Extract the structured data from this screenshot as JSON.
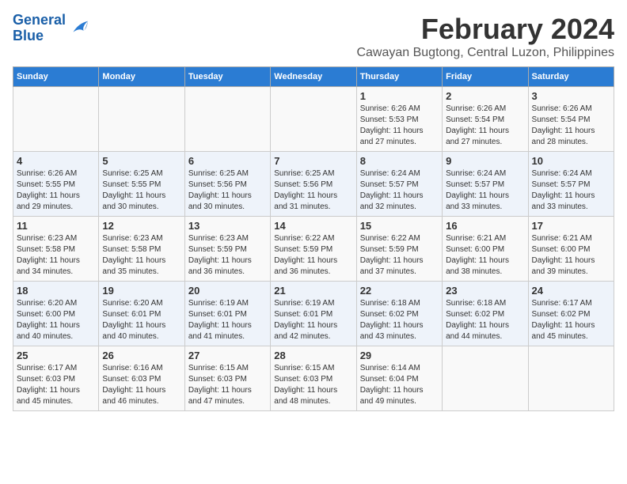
{
  "logo": {
    "line1": "General",
    "line2": "Blue"
  },
  "title": "February 2024",
  "subtitle": "Cawayan Bugtong, Central Luzon, Philippines",
  "days_header": [
    "Sunday",
    "Monday",
    "Tuesday",
    "Wednesday",
    "Thursday",
    "Friday",
    "Saturday"
  ],
  "weeks": [
    [
      {
        "day": "",
        "info": ""
      },
      {
        "day": "",
        "info": ""
      },
      {
        "day": "",
        "info": ""
      },
      {
        "day": "",
        "info": ""
      },
      {
        "day": "1",
        "info": "Sunrise: 6:26 AM\nSunset: 5:53 PM\nDaylight: 11 hours\nand 27 minutes."
      },
      {
        "day": "2",
        "info": "Sunrise: 6:26 AM\nSunset: 5:54 PM\nDaylight: 11 hours\nand 27 minutes."
      },
      {
        "day": "3",
        "info": "Sunrise: 6:26 AM\nSunset: 5:54 PM\nDaylight: 11 hours\nand 28 minutes."
      }
    ],
    [
      {
        "day": "4",
        "info": "Sunrise: 6:26 AM\nSunset: 5:55 PM\nDaylight: 11 hours\nand 29 minutes."
      },
      {
        "day": "5",
        "info": "Sunrise: 6:25 AM\nSunset: 5:55 PM\nDaylight: 11 hours\nand 30 minutes."
      },
      {
        "day": "6",
        "info": "Sunrise: 6:25 AM\nSunset: 5:56 PM\nDaylight: 11 hours\nand 30 minutes."
      },
      {
        "day": "7",
        "info": "Sunrise: 6:25 AM\nSunset: 5:56 PM\nDaylight: 11 hours\nand 31 minutes."
      },
      {
        "day": "8",
        "info": "Sunrise: 6:24 AM\nSunset: 5:57 PM\nDaylight: 11 hours\nand 32 minutes."
      },
      {
        "day": "9",
        "info": "Sunrise: 6:24 AM\nSunset: 5:57 PM\nDaylight: 11 hours\nand 33 minutes."
      },
      {
        "day": "10",
        "info": "Sunrise: 6:24 AM\nSunset: 5:57 PM\nDaylight: 11 hours\nand 33 minutes."
      }
    ],
    [
      {
        "day": "11",
        "info": "Sunrise: 6:23 AM\nSunset: 5:58 PM\nDaylight: 11 hours\nand 34 minutes."
      },
      {
        "day": "12",
        "info": "Sunrise: 6:23 AM\nSunset: 5:58 PM\nDaylight: 11 hours\nand 35 minutes."
      },
      {
        "day": "13",
        "info": "Sunrise: 6:23 AM\nSunset: 5:59 PM\nDaylight: 11 hours\nand 36 minutes."
      },
      {
        "day": "14",
        "info": "Sunrise: 6:22 AM\nSunset: 5:59 PM\nDaylight: 11 hours\nand 36 minutes."
      },
      {
        "day": "15",
        "info": "Sunrise: 6:22 AM\nSunset: 5:59 PM\nDaylight: 11 hours\nand 37 minutes."
      },
      {
        "day": "16",
        "info": "Sunrise: 6:21 AM\nSunset: 6:00 PM\nDaylight: 11 hours\nand 38 minutes."
      },
      {
        "day": "17",
        "info": "Sunrise: 6:21 AM\nSunset: 6:00 PM\nDaylight: 11 hours\nand 39 minutes."
      }
    ],
    [
      {
        "day": "18",
        "info": "Sunrise: 6:20 AM\nSunset: 6:00 PM\nDaylight: 11 hours\nand 40 minutes."
      },
      {
        "day": "19",
        "info": "Sunrise: 6:20 AM\nSunset: 6:01 PM\nDaylight: 11 hours\nand 40 minutes."
      },
      {
        "day": "20",
        "info": "Sunrise: 6:19 AM\nSunset: 6:01 PM\nDaylight: 11 hours\nand 41 minutes."
      },
      {
        "day": "21",
        "info": "Sunrise: 6:19 AM\nSunset: 6:01 PM\nDaylight: 11 hours\nand 42 minutes."
      },
      {
        "day": "22",
        "info": "Sunrise: 6:18 AM\nSunset: 6:02 PM\nDaylight: 11 hours\nand 43 minutes."
      },
      {
        "day": "23",
        "info": "Sunrise: 6:18 AM\nSunset: 6:02 PM\nDaylight: 11 hours\nand 44 minutes."
      },
      {
        "day": "24",
        "info": "Sunrise: 6:17 AM\nSunset: 6:02 PM\nDaylight: 11 hours\nand 45 minutes."
      }
    ],
    [
      {
        "day": "25",
        "info": "Sunrise: 6:17 AM\nSunset: 6:03 PM\nDaylight: 11 hours\nand 45 minutes."
      },
      {
        "day": "26",
        "info": "Sunrise: 6:16 AM\nSunset: 6:03 PM\nDaylight: 11 hours\nand 46 minutes."
      },
      {
        "day": "27",
        "info": "Sunrise: 6:15 AM\nSunset: 6:03 PM\nDaylight: 11 hours\nand 47 minutes."
      },
      {
        "day": "28",
        "info": "Sunrise: 6:15 AM\nSunset: 6:03 PM\nDaylight: 11 hours\nand 48 minutes."
      },
      {
        "day": "29",
        "info": "Sunrise: 6:14 AM\nSunset: 6:04 PM\nDaylight: 11 hours\nand 49 minutes."
      },
      {
        "day": "",
        "info": ""
      },
      {
        "day": "",
        "info": ""
      }
    ]
  ]
}
